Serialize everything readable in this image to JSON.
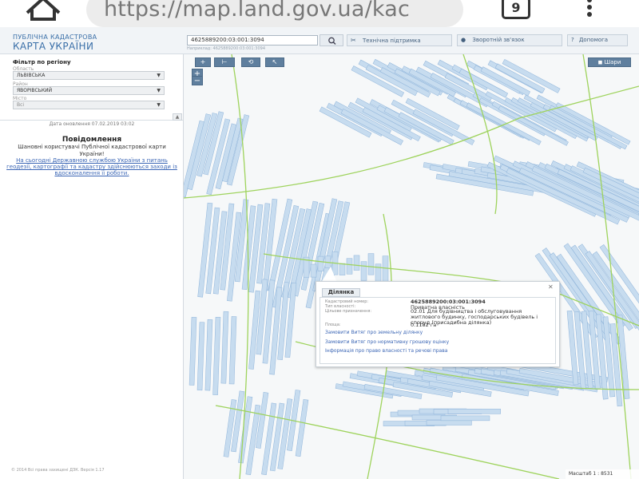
{
  "browser": {
    "url": "https://map.land.gov.ua/kac",
    "tab_count": "9",
    "home_icon": "home-icon",
    "menu_icon": "kebab-menu-icon"
  },
  "header": {
    "logo_top": "ПУБЛІЧНА КАДАСТРОВА",
    "logo_main": "КАРТА УКРАЇНИ",
    "search_value": "4625889200:03:001:3094",
    "search_hint": "Наприклад: 4625889200:03:001:3094",
    "search_icon": "search-icon",
    "buttons": [
      "Технічна підтримка",
      "Зворотній зв'язок",
      "Допомога"
    ]
  },
  "sidebar": {
    "filter_title": "Фільтр по регіону",
    "region_label": "Область",
    "region_value": "ЛЬВІВСЬКА",
    "district_label": "Район",
    "district_value": "ЯВОРІВСЬКИЙ",
    "city_label": "Місто",
    "city_value": "Всі",
    "update_date": "Дата оновлення 07.02.2019 03:02",
    "notice_title": "Повідомлення",
    "notice_greeting": "Шановні користувачі Публічної кадастрової карти України!",
    "notice_link": "На сьогодні Державною службою України з питань геодезії, картографії та кадастру здійснюються заходи із вдосконалення її роботи.",
    "copyright": "© 2014 Всі права захищені ДЗК. Версія 1.17"
  },
  "map": {
    "tools": [
      "+",
      "⊢",
      "⟲",
      "↖"
    ],
    "zoom_in": "+",
    "zoom_out": "−",
    "layers_label": "Шари",
    "scale": "Масштаб 1 : 8531",
    "colors": {
      "parcel_fill": "#c7dcef",
      "parcel_stroke": "#8fb4da",
      "boundary": "#9ed35c",
      "background": "#f6f8f9"
    }
  },
  "popup": {
    "tab": "Ділянка",
    "rows": [
      {
        "label": "Кадастровий номер:",
        "value": "4625889200:03:001:3094",
        "bold": true
      },
      {
        "label": "Тип власності:",
        "value": "Приватна власність",
        "bold": false
      },
      {
        "label": "Цільове призначення:",
        "value": "02.01 Для будівництва і обслуговування житлового будинку, господарських будівель і споруд (присадибна ділянка)",
        "bold": false
      },
      {
        "label": "Площа:",
        "value": "0.1182 га",
        "bold": false
      }
    ],
    "links": [
      "Замовити Витяг про земельну ділянку",
      "Замовити Витяг про нормативну грошову оцінку",
      "Інформація про право власності та речові права"
    ]
  }
}
